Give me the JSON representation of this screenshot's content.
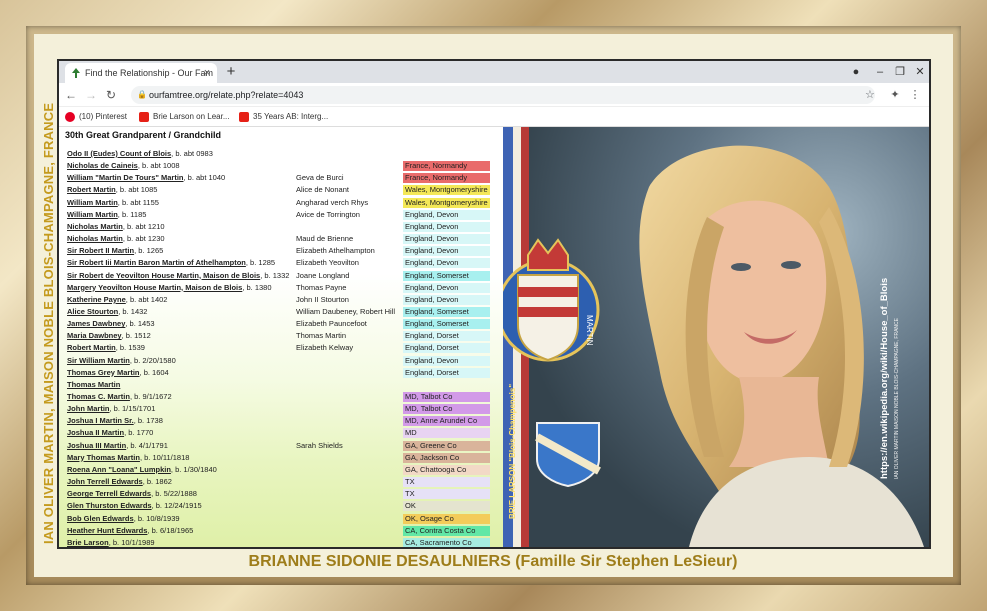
{
  "side_caption": "IAN OLIVER MARTIN, MAISON NOBLE BLOIS-CHAMPAGNE, FRANCE",
  "bottom_caption": "BRIANNE SIDONIE DESAULNIERS (Famille Sir Stephen LeSieur)",
  "browser": {
    "tab_title": "Find the Relationship - Our Fam",
    "url": "ourfamtree.org/relate.php?relate=4043",
    "bookmarks": [
      "(10) Pinterest",
      "Brie Larson on Lear...",
      "35 Years AB: Interg..."
    ]
  },
  "genealogy": {
    "title": "30th Great Grandparent / Grandchild",
    "rows": [
      {
        "name": "Odo II (Eudes) Count of Blois",
        "birth": ", b. abt 0983",
        "spouse": "",
        "location": "",
        "color": ""
      },
      {
        "name": "Nicholas de Caineis",
        "birth": ", b. abt 1008",
        "spouse": "",
        "location": "France, Normandy",
        "color": "c-red"
      },
      {
        "name": "William \"Martin De Tours\" Martin",
        "birth": ", b. abt 1040",
        "spouse": "Geva de Burci",
        "location": "France, Normandy",
        "color": "c-red"
      },
      {
        "name": "Robert Martin",
        "birth": ", b. abt 1085",
        "spouse": "Alice de Nonant",
        "location": "Wales, Montgomeryshire",
        "color": "c-yellow"
      },
      {
        "name": "William Martin",
        "birth": ", b. abt 1155",
        "spouse": "Angharad verch Rhys",
        "location": "Wales, Montgomeryshire",
        "color": "c-yellow"
      },
      {
        "name": "William Martin",
        "birth": ", b. 1185",
        "spouse": "Avice de Torrington",
        "location": "England, Devon",
        "color": "c-cyan"
      },
      {
        "name": "Nicholas Martin",
        "birth": ", b. abt 1210",
        "spouse": "",
        "location": "England, Devon",
        "color": "c-cyan"
      },
      {
        "name": "Nicholas Martin",
        "birth": ", b. abt 1230",
        "spouse": "Maud de Brienne",
        "location": "England, Devon",
        "color": "c-cyan"
      },
      {
        "name": "Sir Robert II Martin",
        "birth": ", b. 1265",
        "spouse": "Elizabeth Athelhampton",
        "location": "England, Devon",
        "color": "c-cyan"
      },
      {
        "name": "Sir Robert Iii Martin Baron Martin of Athelhampton",
        "birth": ", b. 1285",
        "spouse": "Elizabeth Yeovilton",
        "location": "England, Devon",
        "color": "c-cyan"
      },
      {
        "name": "Sir Robert de Yeovilton House Martin, Maison de Blois",
        "birth": ", b. 1332",
        "spouse": "Joane Longland",
        "location": "England, Somerset",
        "color": "c-cyan2"
      },
      {
        "name": "Margery Yeovilton House Martin, Maison de Blois",
        "birth": ", b. 1380",
        "spouse": "Thomas Payne",
        "location": "England, Devon",
        "color": "c-cyan"
      },
      {
        "name": "Katherine Payne",
        "birth": ", b. abt 1402",
        "spouse": "John II Stourton",
        "location": "England, Devon",
        "color": "c-cyan"
      },
      {
        "name": "Alice Stourton",
        "birth": ", b. 1432",
        "spouse": "William Daubeney, Robert Hill",
        "location": "England, Somerset",
        "color": "c-cyan2"
      },
      {
        "name": "James Dawbney",
        "birth": ", b. 1453",
        "spouse": "Elizabeth Pauncefoot",
        "location": "England, Somerset",
        "color": "c-cyan2"
      },
      {
        "name": "Maria Dawbney",
        "birth": ", b. 1512",
        "spouse": "Thomas Martin",
        "location": "England, Dorset",
        "color": "c-cyan"
      },
      {
        "name": "Robert Martin",
        "birth": ", b. 1539",
        "spouse": "Elizabeth Kelway",
        "location": "England, Dorset",
        "color": "c-cyan"
      },
      {
        "name": "Sir William Martin",
        "birth": ", b. 2/20/1580",
        "spouse": "",
        "location": "England, Devon",
        "color": "c-cyan"
      },
      {
        "name": "Thomas Grey Martin",
        "birth": ", b. 1604",
        "spouse": "",
        "location": "England, Dorset",
        "color": "c-cyan"
      },
      {
        "name": "Thomas Martin",
        "birth": "",
        "spouse": "",
        "location": "",
        "color": ""
      },
      {
        "name": "Thomas C. Martin",
        "birth": ", b. 9/1/1672",
        "spouse": "",
        "location": "MD, Talbot Co",
        "color": "c-purple"
      },
      {
        "name": "John Martin",
        "birth": ", b. 1/15/1701",
        "spouse": "",
        "location": "MD, Talbot Co",
        "color": "c-purple"
      },
      {
        "name": "Joshua I Martin Sr.",
        "birth": ", b. 1738",
        "spouse": "",
        "location": "MD, Anne Arundel Co",
        "color": "c-purple"
      },
      {
        "name": "Joshua II Martin",
        "birth": ", b. 1770",
        "spouse": "",
        "location": "MD",
        "color": "c-lav"
      },
      {
        "name": "Joshua III Martin",
        "birth": ", b. 4/1/1791",
        "spouse": "Sarah Shields",
        "location": "GA, Greene Co",
        "color": "c-brown"
      },
      {
        "name": "Mary Thomas Martin",
        "birth": ", b. 10/11/1818",
        "spouse": "",
        "location": "GA, Jackson Co",
        "color": "c-brown"
      },
      {
        "name": "Roena Ann \"Loana\" Lumpkin",
        "birth": ", b. 1/30/1840",
        "spouse": "",
        "location": "GA, Chattooga Co",
        "color": "c-peach"
      },
      {
        "name": "John Terrell Edwards",
        "birth": ", b. 1862",
        "spouse": "",
        "location": "TX",
        "color": "c-lpurple"
      },
      {
        "name": "George Terrell Edwards",
        "birth": ", b. 5/22/1888",
        "spouse": "",
        "location": "TX",
        "color": "c-lpurple"
      },
      {
        "name": "Glen Thurston Edwards",
        "birth": ", b. 12/24/1915",
        "spouse": "",
        "location": "OK",
        "color": "c-ok"
      },
      {
        "name": "Bob Glen Edwards",
        "birth": ", b. 10/8/1939",
        "spouse": "",
        "location": "OK, Osage Co",
        "color": "c-okosage"
      },
      {
        "name": "Heather Hunt Edwards",
        "birth": ", b. 6/18/1965",
        "spouse": "",
        "location": "CA, Contra Costa Co",
        "color": "c-green"
      },
      {
        "name": "Brie Larson",
        "birth": ", b. 10/1/1989",
        "spouse": "",
        "location": "CA, Sacramento Co",
        "color": "c-cac"
      }
    ]
  },
  "photo": {
    "vertical_text": "BRIE LARSON \"Blois-Champenois\"",
    "crest_label": "MARTIN",
    "wiki_url": "https://en.wikipedia.org/wiki/House_of_Blois",
    "wiki_sub": "IAN OLIVER MARTIN MAISON NOBLE BLOIS-CHAMPAGNE, FRANCE"
  }
}
